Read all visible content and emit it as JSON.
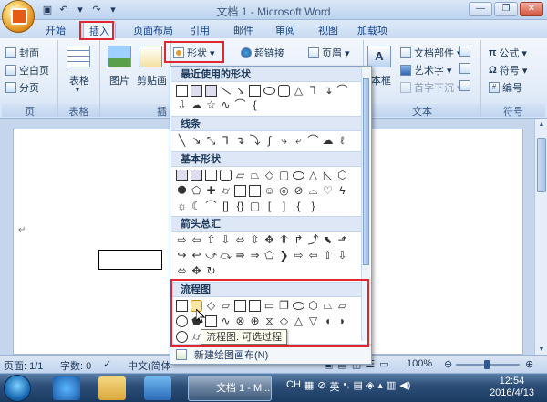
{
  "window": {
    "title": "文档 1 - Microsoft Word"
  },
  "tabs": [
    "开始",
    "插入",
    "页面布局",
    "引用",
    "邮件",
    "审阅",
    "视图",
    "加载项"
  ],
  "ribbon": {
    "pages_group": {
      "label": "页",
      "items": [
        "封面",
        "空白页",
        "分页"
      ]
    },
    "table_group": {
      "label": "表格",
      "table": "表格"
    },
    "illustrations_group": {
      "label": "插",
      "picture": "图片",
      "clipart": "剪贴画",
      "shapes": "形状",
      "shapes_arrow": "▾"
    },
    "links": {
      "hyperlink": "超链接"
    },
    "header_footer": {
      "header": "页眉"
    },
    "text_group": {
      "label": "文本",
      "textbox": "本框",
      "quickparts": "文档部件",
      "wordart": "艺术字",
      "dropcap": "首字下沉"
    },
    "symbols_group": {
      "label": "符号",
      "formula": "公式",
      "symbol": "符号",
      "number": "编号"
    }
  },
  "shapes_menu": {
    "sections": [
      "最近使用的形状",
      "线条",
      "基本形状",
      "箭头总汇",
      "流程图"
    ],
    "new_canvas": "新建绘图画布(N)",
    "new_canvas_underline": "N"
  },
  "tooltip": "流程图: 可选过程",
  "document": {
    "paragraph_mark": "↵"
  },
  "statusbar": {
    "page": "页面: 1/1",
    "words": "字数: 0",
    "language": "中文(简体",
    "zoom": "100%"
  },
  "taskbar": {
    "word_button": "文档 1 - M...",
    "ime_label": "CH",
    "ime_mode": "英",
    "time": "12:54",
    "date": "2016/4/13"
  }
}
